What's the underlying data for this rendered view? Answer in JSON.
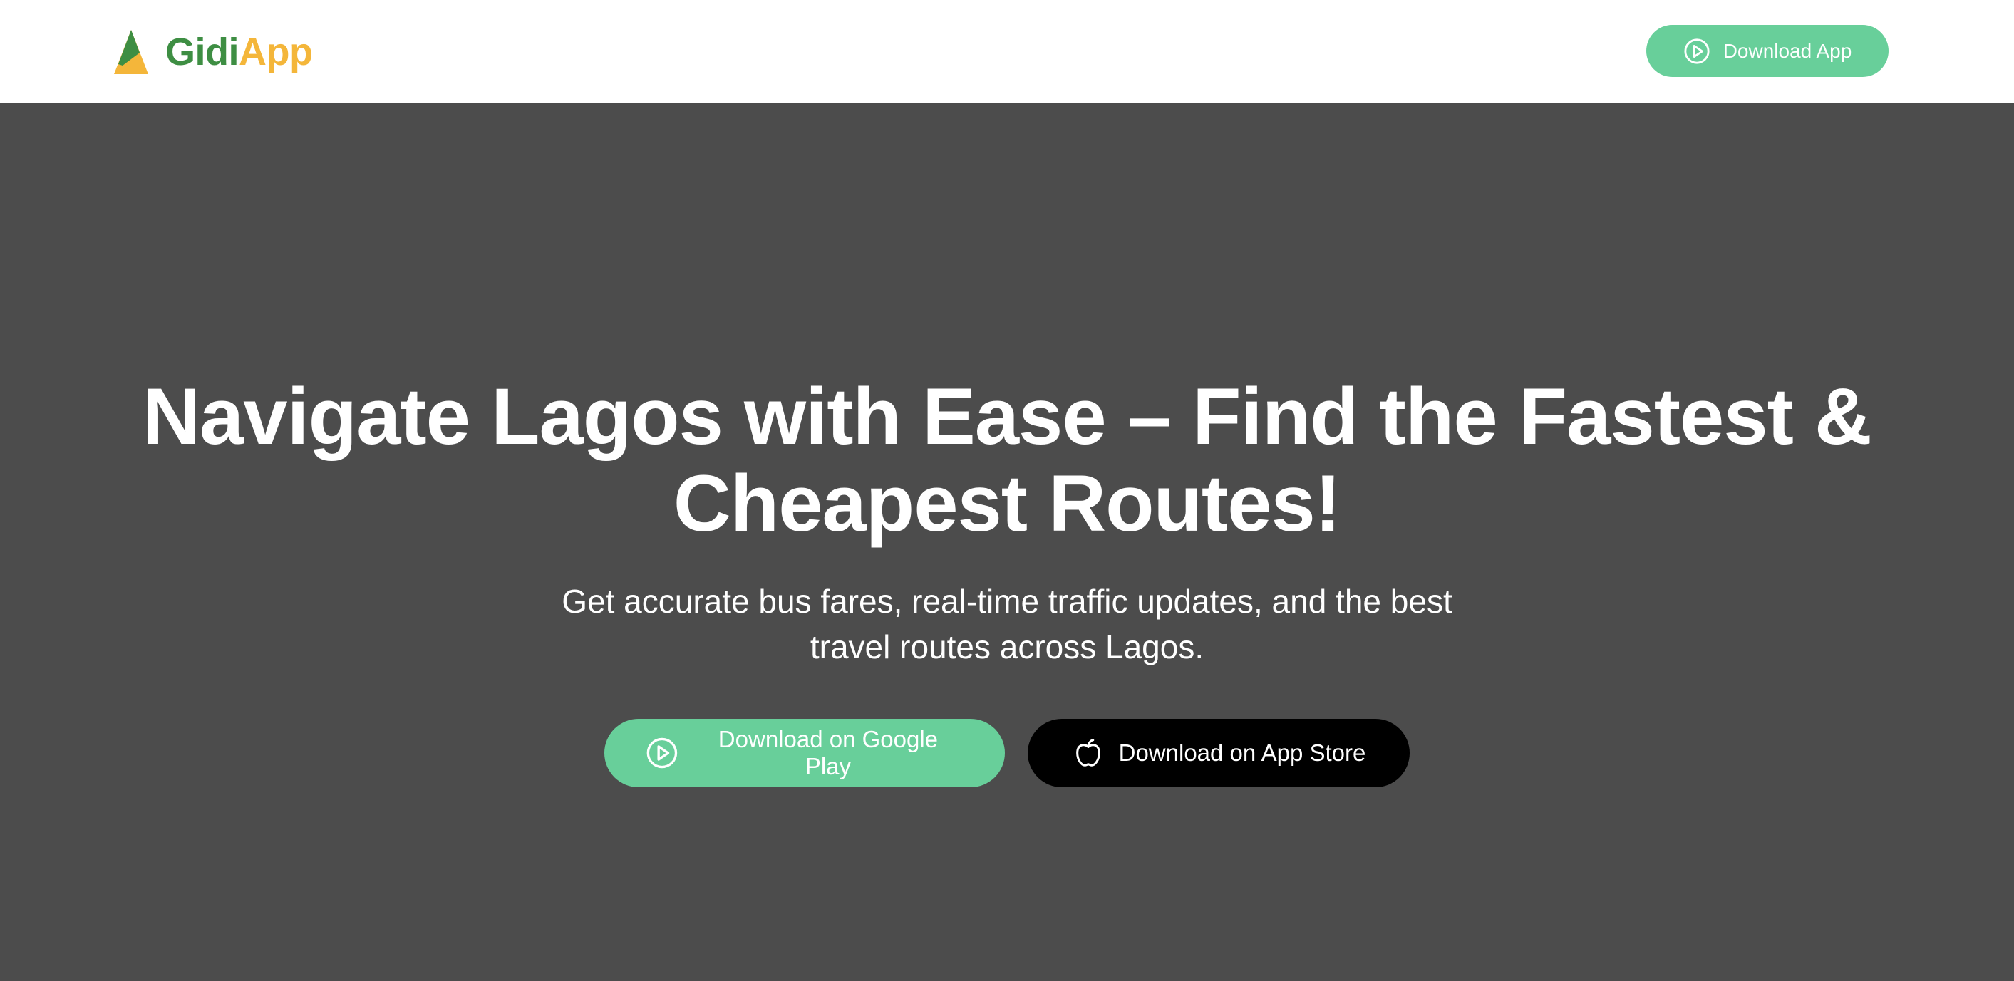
{
  "brand": {
    "name_part1": "Gidi",
    "name_part2": "App",
    "logo_icon": "triangle-logo-icon",
    "colors": {
      "green": "#3e8e43",
      "yellow": "#f4b63a"
    }
  },
  "nav": {
    "download_label": "Download App",
    "download_icon": "play-circle-icon",
    "accent": "#68cf9a"
  },
  "hero": {
    "title": "Navigate Lagos with Ease – Find the Fastest & Cheapest Routes!",
    "subtitle": "Get accurate bus fares, real-time traffic updates, and the best travel routes across Lagos.",
    "background": "#4c4c4c",
    "cta_google": {
      "label": "Download on Google Play",
      "icon": "play-circle-icon",
      "color": "#68cf9a"
    },
    "cta_apple": {
      "label": "Download on App Store",
      "icon": "apple-icon",
      "color": "#000000"
    }
  }
}
